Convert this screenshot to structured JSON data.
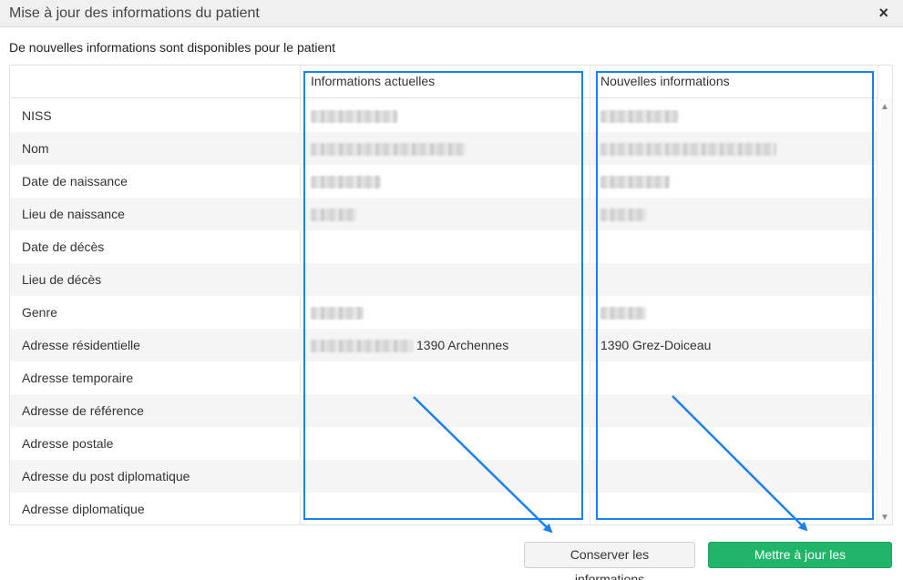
{
  "dialog": {
    "title": "Mise à jour des informations du patient",
    "close_symbol": "×"
  },
  "subtitle": "De nouvelles informations sont disponibles pour le patient",
  "table": {
    "headers": [
      "",
      "Informations actuelles",
      "Nouvelles informations"
    ],
    "rows": [
      {
        "label": "NISS",
        "current": "",
        "new": "",
        "current_redacted": true,
        "new_redacted": true
      },
      {
        "label": "Nom",
        "current": "",
        "new": "",
        "current_redacted": true,
        "new_redacted": true
      },
      {
        "label": "Date de naissance",
        "current": "",
        "new": "",
        "current_redacted": true,
        "new_redacted": true
      },
      {
        "label": "Lieu de naissance",
        "current": "",
        "new": "",
        "current_redacted": true,
        "new_redacted": true
      },
      {
        "label": "Date de décès",
        "current": "",
        "new": "",
        "current_redacted": false,
        "new_redacted": false
      },
      {
        "label": "Lieu de décès",
        "current": "",
        "new": "",
        "current_redacted": false,
        "new_redacted": false
      },
      {
        "label": "Genre",
        "current": "",
        "new": "",
        "current_redacted": true,
        "new_redacted": true
      },
      {
        "label": "Adresse résidentielle",
        "current": "1390 Archennes",
        "new": "1390 Grez-Doiceau",
        "current_redacted": true,
        "new_redacted": false
      },
      {
        "label": "Adresse temporaire",
        "current": "",
        "new": "",
        "current_redacted": false,
        "new_redacted": false
      },
      {
        "label": "Adresse de référence",
        "current": "",
        "new": "",
        "current_redacted": false,
        "new_redacted": false
      },
      {
        "label": "Adresse postale",
        "current": "",
        "new": "",
        "current_redacted": false,
        "new_redacted": false
      },
      {
        "label": "Adresse du post diplomatique",
        "current": "",
        "new": "",
        "current_redacted": false,
        "new_redacted": false
      },
      {
        "label": "Adresse diplomatique",
        "current": "",
        "new": "",
        "current_redacted": false,
        "new_redacted": false
      }
    ]
  },
  "scrollbar": {
    "up": "▲",
    "down": "▼"
  },
  "buttons": {
    "keep": "Conserver les informations",
    "update": "Mettre à jour les informations"
  },
  "colors": {
    "highlight": "#1a7ff0",
    "primary_button": "#21b56a",
    "alt_row": "#f5f5f5"
  },
  "icons": [
    "close-icon",
    "scroll-up-icon",
    "scroll-down-icon",
    "annotation-arrow-icon"
  ]
}
